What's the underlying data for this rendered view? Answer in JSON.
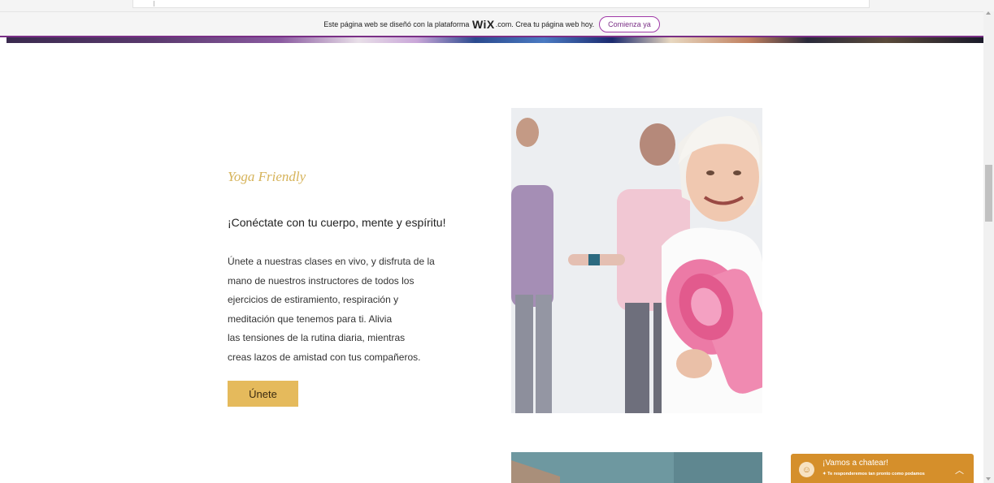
{
  "banner": {
    "text_before": "Este página web se diseñó con la plataforma",
    "logo": "WiX",
    "text_after": ".com. Crea tu página web hoy.",
    "cta_label": "Comienza ya"
  },
  "section": {
    "title": "Yoga Friendly",
    "subtitle": "¡Conéctate con tu cuerpo, mente y espíritu!",
    "body_lines": [
      "Únete a nuestras clases en vivo, y disfruta de la",
      "mano de nuestros instructores de todos los",
      "ejercicios de estiramiento, respiración y",
      "meditación que tenemos para ti.  Alivia",
      "las tensiones de la rutina diaria, mientras",
      "creas lazos de amistad con tus compañeros."
    ],
    "button_label": "Únete"
  },
  "chat": {
    "title": "¡Vamos a chatear!",
    "subtitle": "Te responderemos tan pronto como podamos",
    "toggle_icon": "chevron-up-icon"
  },
  "colors": {
    "accent_gold": "#e5ba5c",
    "title_gold": "#d6b35a",
    "wix_purple": "#7a2f86",
    "chat_orange": "#d58f2b"
  }
}
